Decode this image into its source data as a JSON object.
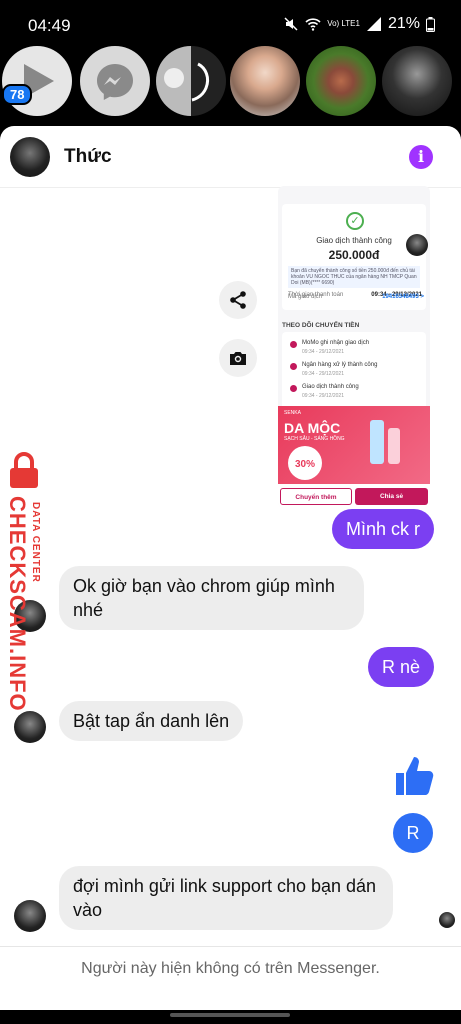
{
  "status_bar": {
    "time": "04:49",
    "battery": "21%",
    "network": "Vo) LTE1"
  },
  "chat_heads": {
    "unread_badge": "78"
  },
  "conversation": {
    "contact_name": "Thức",
    "info_icon": "i"
  },
  "receipt": {
    "status": "Giao dịch thành công",
    "amount": "250.000đ",
    "note": "Bạn đã chuyển thành công số tiền 250.000đ đến chủ tài khoản VU NGOC THUC của ngân hàng NH TMCP Quan Doi (MB)(**** 6690)",
    "time_label": "Thời gian thanh toán",
    "time_value": "09:34 - 29/12/2021",
    "code_label": "Mã giao dịch",
    "code_value": "19416348493 >",
    "track_title": "THEO DÕI CHUYỂN TIỀN",
    "steps": [
      {
        "label": "MoMo ghi nhận giao dịch",
        "time": "09:34 - 29/12/2021"
      },
      {
        "label": "Ngân hàng xử lý thành công",
        "time": "09:34 - 29/12/2021"
      },
      {
        "label": "Giao dịch thành công",
        "time": "09:34 - 29/12/2021"
      }
    ],
    "ad_brand": "SENKA",
    "ad_title": "DA MỘC",
    "ad_subtitle": "SẠCH SÂU - SÁNG HỒNG",
    "ad_discount": "30%",
    "btn_transfer_more": "Chuyển thêm",
    "btn_share": "Chia sẻ"
  },
  "messages": [
    {
      "sender": "me",
      "text": "Mình ck r"
    },
    {
      "sender": "them",
      "text": "Ok giờ bạn vào chrom giúp mình nhé"
    },
    {
      "sender": "me",
      "text": "R nè"
    },
    {
      "sender": "them",
      "text": "Bật tap ẩn danh lên"
    },
    {
      "sender": "me",
      "text": "R"
    },
    {
      "sender": "them",
      "text": "đợi mình gửi link support cho bạn dán vào"
    }
  ],
  "footer": {
    "notice": "Người này hiện không có trên Messenger."
  },
  "watermark": {
    "main": "CHECKSCAM.INFO",
    "sub": "DATA CENTER"
  },
  "colors": {
    "my_bubble": "#7b3ff2",
    "their_bubble": "#ededed",
    "like": "#2d6ef5",
    "info": "#a033ff",
    "watermark": "#e53935"
  }
}
